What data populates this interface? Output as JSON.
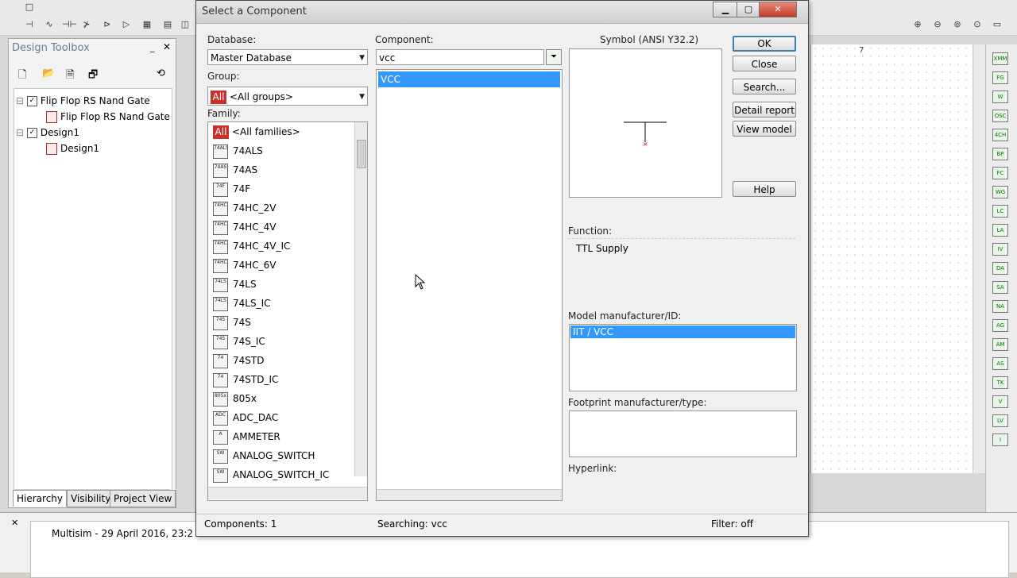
{
  "app": {
    "toolbox_title": "Design Toolbox",
    "tree": [
      {
        "label": "Flip Flop RS Nand Gate",
        "checked": true
      },
      {
        "label": "Flip Flop RS Nand Gate",
        "child": true
      },
      {
        "label": "Design1",
        "checked": true
      },
      {
        "label": "Design1",
        "child": true
      }
    ],
    "tabs": [
      "Hierarchy",
      "Visibility",
      "Project View"
    ],
    "log_text": "Multisim  -  29 April 2016, 23:2",
    "ruler_mark": "7"
  },
  "dialog": {
    "title": "Select a Component",
    "database_label": "Database:",
    "database_value": "Master Database",
    "group_label": "Group:",
    "group_icon": "All",
    "group_value": "<All groups>",
    "family_label": "Family:",
    "families": [
      {
        "icon": "All",
        "label": "<All families>"
      },
      {
        "icon": "74ALS",
        "label": "74ALS"
      },
      {
        "icon": "74AS",
        "label": "74AS"
      },
      {
        "icon": "74F",
        "label": "74F"
      },
      {
        "icon": "74HC",
        "label": "74HC_2V"
      },
      {
        "icon": "74HC",
        "label": "74HC_4V"
      },
      {
        "icon": "74HC",
        "label": "74HC_4V_IC"
      },
      {
        "icon": "74HC",
        "label": "74HC_6V"
      },
      {
        "icon": "74LS",
        "label": "74LS"
      },
      {
        "icon": "74LS",
        "label": "74LS_IC"
      },
      {
        "icon": "74S",
        "label": "74S"
      },
      {
        "icon": "74S",
        "label": "74S_IC"
      },
      {
        "icon": "74",
        "label": "74STD"
      },
      {
        "icon": "74",
        "label": "74STD_IC"
      },
      {
        "icon": "805x",
        "label": "805x"
      },
      {
        "icon": "ADC",
        "label": "ADC_DAC"
      },
      {
        "icon": "A",
        "label": "AMMETER"
      },
      {
        "icon": "SW",
        "label": "ANALOG_SWITCH"
      },
      {
        "icon": "SW",
        "label": "ANALOG_SWITCH_IC"
      }
    ],
    "component_label": "Component:",
    "component_value": "vcc",
    "components": [
      "VCC"
    ],
    "symbol_label": "Symbol (ANSI Y32.2)",
    "buttons": {
      "ok": "OK",
      "close": "Close",
      "search": "Search...",
      "detail": "Detail report",
      "view_model": "View model",
      "help": "Help"
    },
    "function_label": "Function:",
    "function_value": "TTL Supply",
    "model_label": "Model manufacturer/ID:",
    "model_value": "IIT / VCC",
    "footprint_label": "Footprint manufacturer/type:",
    "hyperlink_label": "Hyperlink:",
    "status": {
      "components": "Components: 1",
      "searching": "Searching: vcc",
      "filter": "Filter: off"
    }
  }
}
